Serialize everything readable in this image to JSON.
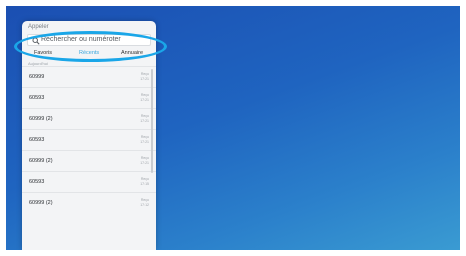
{
  "panel": {
    "title": "Appeler",
    "search": {
      "placeholder": "Rechercher ou numéroter"
    },
    "tabs": [
      {
        "label": "Favoris",
        "active": false
      },
      {
        "label": "Récents",
        "active": true
      },
      {
        "label": "Annuaire",
        "active": false
      }
    ],
    "section_label": "Aujourd'hui",
    "rows": [
      {
        "name": "60999",
        "meta_top": "Reçu",
        "meta_bottom": "17:21"
      },
      {
        "name": "60593",
        "meta_top": "Reçu",
        "meta_bottom": "17:21"
      },
      {
        "name": "60999 (2)",
        "meta_top": "Reçu",
        "meta_bottom": "17:21"
      },
      {
        "name": "60593",
        "meta_top": "Reçu",
        "meta_bottom": "17:21"
      },
      {
        "name": "60999 (2)",
        "meta_top": "Reçu",
        "meta_bottom": "17:21"
      },
      {
        "name": "60593",
        "meta_top": "Reçu",
        "meta_bottom": "17:15"
      },
      {
        "name": "60999 (2)",
        "meta_top": "Reçu",
        "meta_bottom": "17:12"
      }
    ]
  },
  "colors": {
    "accent": "#3aa7de",
    "highlight": "#1aa6e8",
    "background_top": "#1b4fb2",
    "background_bottom": "#3a9bd2"
  },
  "icons": {
    "search": "search-icon"
  }
}
